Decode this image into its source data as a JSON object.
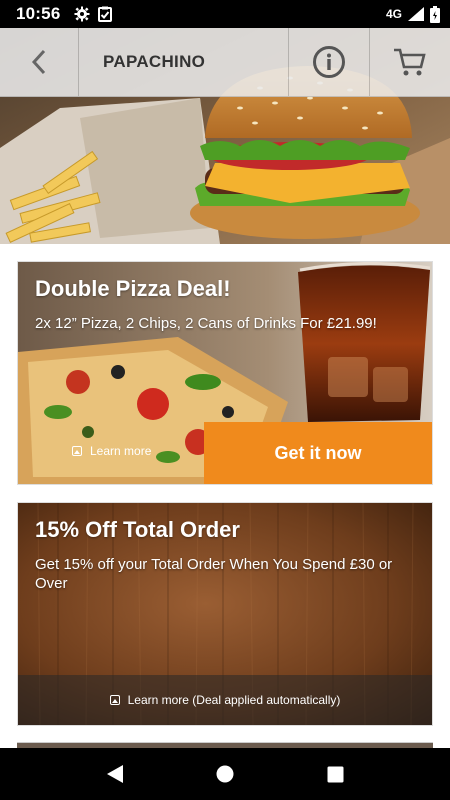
{
  "status_bar": {
    "time": "10:56",
    "network": "4G"
  },
  "header": {
    "title": "PAPACHINO"
  },
  "deals": [
    {
      "title": "Double Pizza Deal!",
      "description": "2x 12” Pizza, 2 Chips, 2 Cans of Drinks For £21.99!",
      "learn_more": "Learn more",
      "cta": "Get it now"
    },
    {
      "title": "15% Off Total Order",
      "description": "Get 15% off your Total Order When You Spend £30 or Over",
      "learn_more": "Learn more (Deal applied automatically)"
    }
  ],
  "colors": {
    "accent": "#f08a1c",
    "app_bar": "#ebebeb",
    "text_dark": "#333333"
  },
  "icons": [
    "back-arrow-icon",
    "info-icon",
    "cart-icon",
    "settings-icon",
    "clipboard-check-icon",
    "signal-icon",
    "battery-icon",
    "image-icon",
    "nav-back-icon",
    "nav-home-icon",
    "nav-recents-icon"
  ]
}
